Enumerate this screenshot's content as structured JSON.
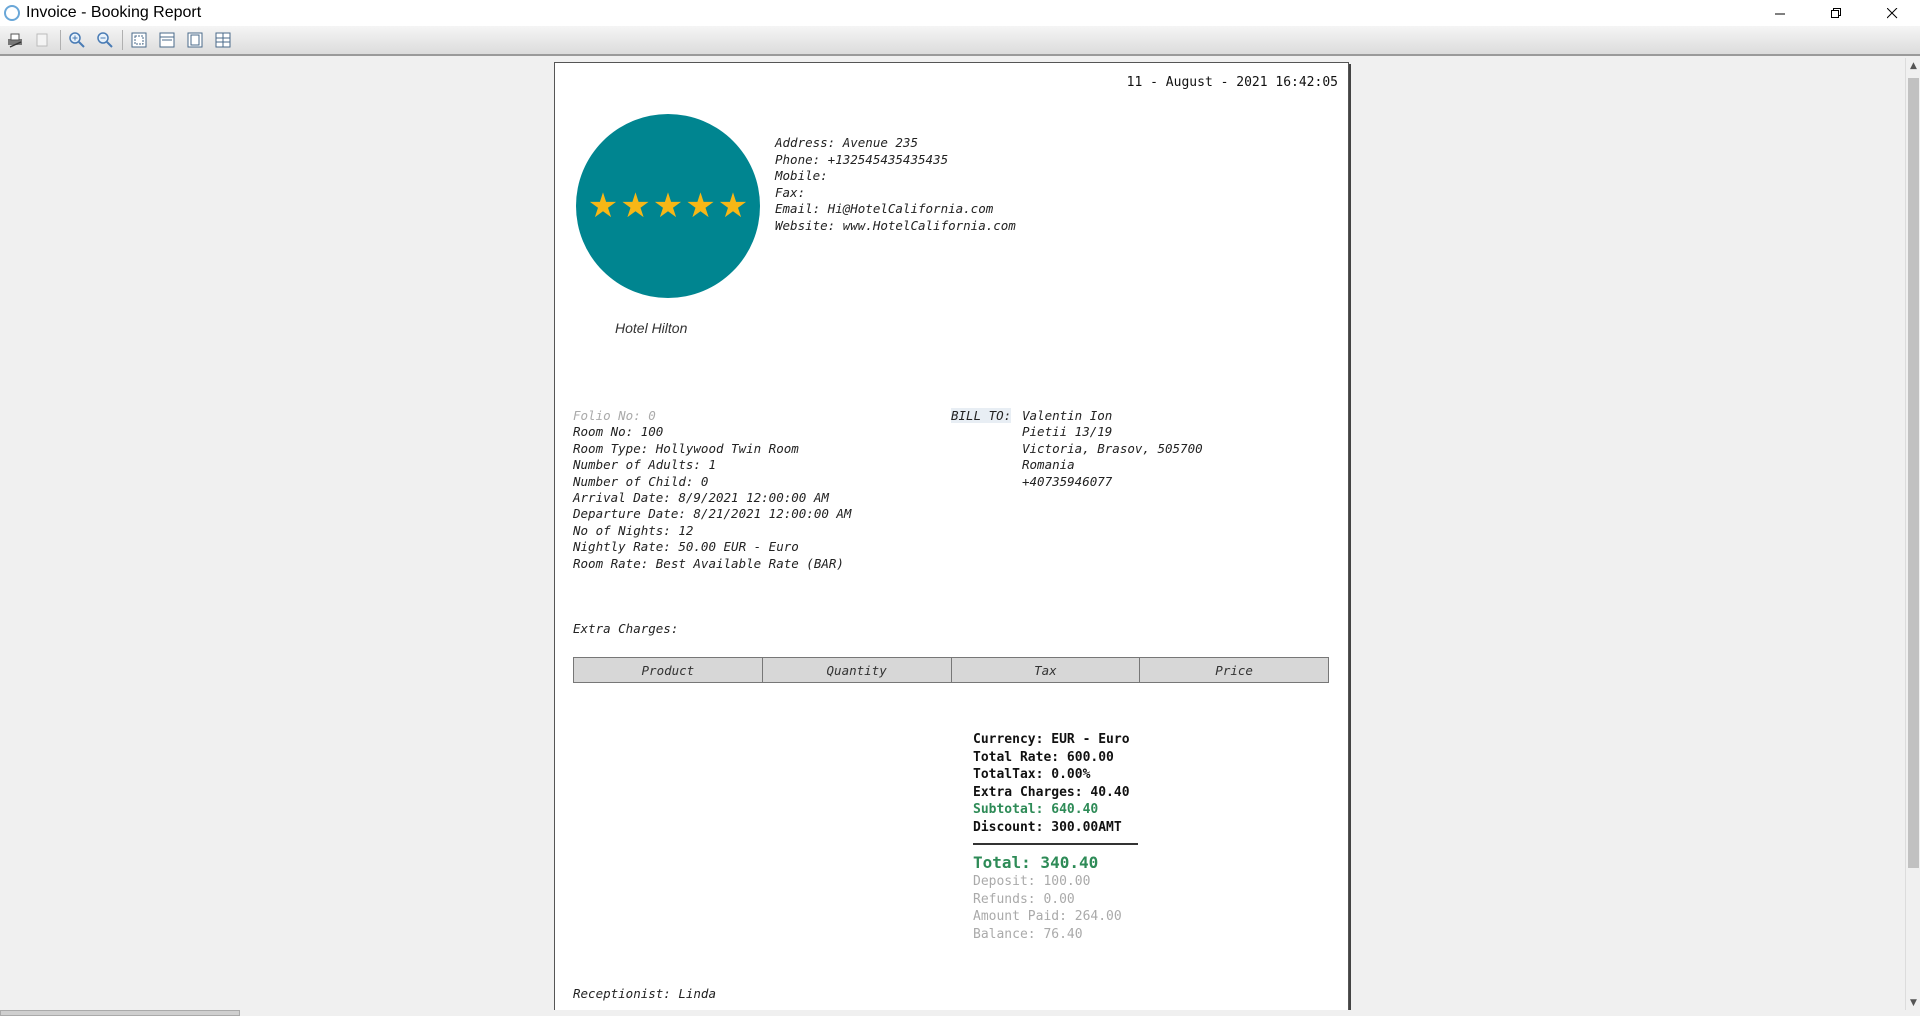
{
  "window": {
    "title": "Invoice - Booking Report"
  },
  "report": {
    "datetime": "11 - August - 2021 16:42:05",
    "hotel_name": "Hotel Hilton",
    "stars": 5,
    "contact": {
      "address": "Address: Avenue 235",
      "phone": "Phone: +132545435435435",
      "mobile": "Mobile:",
      "fax": "Fax:",
      "email": "Email: Hi@HotelCalifornia.com",
      "website": "Website: www.HotelCalifornia.com"
    },
    "booking": {
      "folio": "Folio No: 0",
      "room_no": "Room No: 100",
      "room_type": "Room Type: Hollywood Twin Room",
      "adults": "Number of Adults: 1",
      "child": "Number of Child: 0",
      "arrival": "Arrival Date: 8/9/2021 12:00:00 AM",
      "departure": "Departure Date: 8/21/2021 12:00:00 AM",
      "nights": "No of Nights: 12",
      "nightly_rate": "Nightly Rate: 50.00 EUR - Euro",
      "room_rate": "Room Rate: Best Available Rate (BAR)"
    },
    "bill_to": {
      "label": "BILL TO:",
      "name": "Valentin Ion",
      "street": "Pietii 13/19",
      "city": "Victoria, Brasov, 505700",
      "country": "Romania",
      "phone": "+40735946077"
    },
    "extra_charges_label": "Extra Charges:",
    "table_headers": [
      "Product",
      "Quantity",
      "Tax",
      "Price"
    ],
    "totals": {
      "currency": "Currency: EUR - Euro",
      "total_rate": "Total Rate: 600.00",
      "total_tax": "TotalTax: 0.00%",
      "extra_charges": "Extra Charges: 40.40",
      "subtotal": "Subtotal: 640.40",
      "discount": "Discount: 300.00AMT",
      "total": "Total: 340.40",
      "deposit": "Deposit: 100.00",
      "refunds": "Refunds: 0.00",
      "amount_paid": "Amount Paid: 264.00",
      "balance": "Balance: 76.40"
    },
    "receptionist": "Receptionist: Linda"
  },
  "colors": {
    "logo_bg": "#008590",
    "star": "#f7b716",
    "subtotal": "#2e8b57"
  }
}
